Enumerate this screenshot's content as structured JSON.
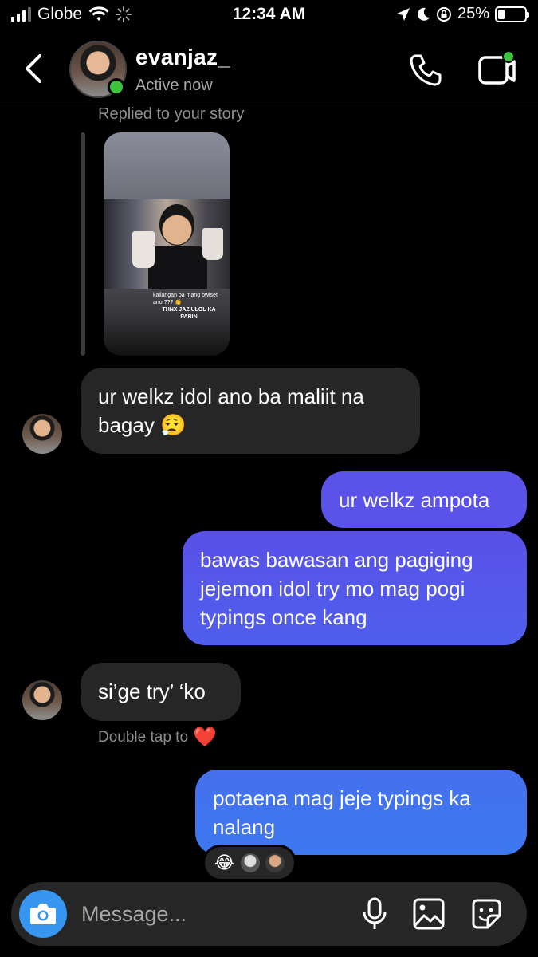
{
  "status_bar": {
    "carrier": "Globe",
    "time": "12:34 AM",
    "battery": "25%",
    "battery_level": 0.25
  },
  "header": {
    "username": "evanjaz_",
    "status": "Active now",
    "back_icon": "chevron-left-icon",
    "call_icon": "phone-icon",
    "video_icon": "video-icon"
  },
  "story_reply": {
    "label": "Replied to your story",
    "caption_line1": "kailangan pa mang bwiset ano ??? 👏",
    "caption_line2": "THNX JAZ ULOL KA PARIN"
  },
  "messages": [
    {
      "sender": "them",
      "text": "ur welkz idol ano ba maliit na bagay 😮‍💨"
    },
    {
      "sender": "me",
      "text": "ur welkz ampota"
    },
    {
      "sender": "me",
      "text": "bawas bawasan ang pagiging jejemon idol try mo mag pogi typings once kang"
    },
    {
      "sender": "them",
      "text": "si’ge try’ ‘ko"
    },
    {
      "sender": "me",
      "text": "potaena mag jeje typings ka nalang"
    }
  ],
  "hint": {
    "text": "Double tap to",
    "emoji": "❤️"
  },
  "reactions": {
    "emoji": "😂"
  },
  "composer": {
    "placeholder": "Message...",
    "camera_icon": "camera-icon",
    "mic_icon": "microphone-icon",
    "gallery_icon": "image-icon",
    "sticker_icon": "sticker-icon"
  },
  "colors": {
    "background": "#000000",
    "incoming_bubble": "#262626",
    "outgoing_bubble_top": "#5b51e8",
    "outgoing_bubble_bottom": "#3f6ef0",
    "online": "#3ec33e",
    "camera_button": "#3797f0"
  }
}
